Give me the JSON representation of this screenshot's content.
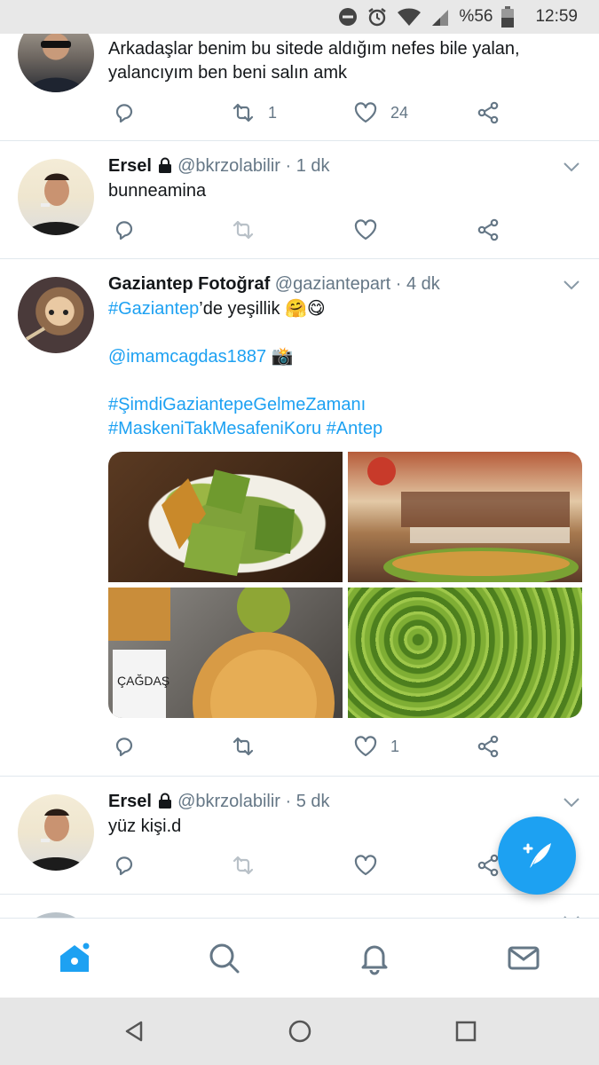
{
  "status_bar": {
    "battery": "%56",
    "time": "12:59"
  },
  "tweets": [
    {
      "text": "Arkadaşlar benim bu sitede aldığım nefes bile yalan, yalancıyım ben beni salın amk",
      "reply_count": "",
      "retweet_count": "1",
      "like_count": "24"
    },
    {
      "name": "Ersel",
      "handle": "@bkrzolabilir",
      "time": "1 dk",
      "text": "bunneamina"
    },
    {
      "name": "Gaziantep Fotoğraf",
      "handle": "@gaziantepart",
      "time": "4 dk",
      "hashtag_main": "#Gaziantep",
      "text_rest": "’de yeşillik 🤗😋",
      "mention": "@imamcagdas1887",
      "camera": "📸",
      "hashtag_line1": "#ŞimdiGaziantepeGelmeZamanı",
      "hashtag_line2": "#MaskeniTakMesafeniKoru #Antep",
      "like_count": "1"
    },
    {
      "name": "Ersel",
      "handle": "@bkrzolabilir",
      "time": "5 dk",
      "text": "yüz kişi.d"
    }
  ],
  "separator": "·",
  "colors": {
    "accent": "#1da1f2",
    "muted": "#657786",
    "text": "#14171a"
  },
  "icons": [
    "reply-icon",
    "retweet-icon",
    "like-icon",
    "share-icon",
    "caret-down-icon",
    "lock-icon",
    "compose-icon",
    "home-icon",
    "search-icon",
    "notifications-icon",
    "messages-icon"
  ]
}
